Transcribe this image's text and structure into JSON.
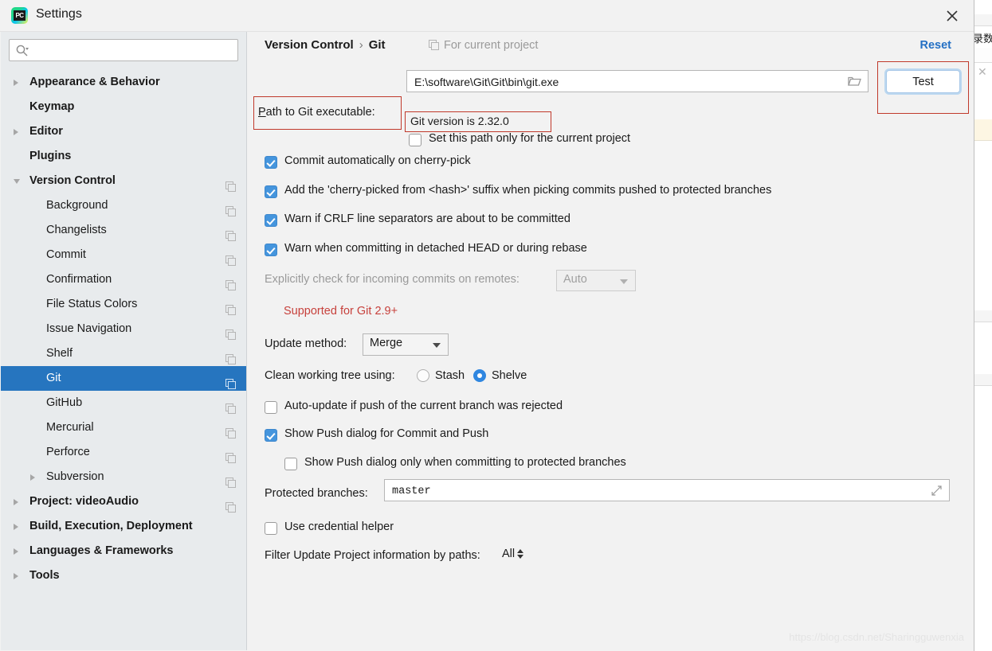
{
  "window": {
    "title": "Settings",
    "logo_icon": "pycharm-logo-icon",
    "close_icon": "close-icon"
  },
  "sidebar": {
    "search": {
      "value": "",
      "placeholder": "",
      "icon": "search-icon"
    },
    "items": [
      {
        "label": "Appearance & Behavior",
        "arrow": "right",
        "bold": true,
        "indent": 36,
        "copy": false,
        "selected": false
      },
      {
        "label": "Keymap",
        "arrow": "none",
        "bold": true,
        "indent": 36,
        "copy": false,
        "selected": false
      },
      {
        "label": "Editor",
        "arrow": "right",
        "bold": true,
        "indent": 36,
        "copy": false,
        "selected": false
      },
      {
        "label": "Plugins",
        "arrow": "none",
        "bold": true,
        "indent": 36,
        "copy": false,
        "selected": false
      },
      {
        "label": "Version Control",
        "arrow": "down",
        "bold": true,
        "indent": 36,
        "copy": true,
        "selected": false
      },
      {
        "label": "Background",
        "arrow": "none",
        "bold": false,
        "indent": 57,
        "copy": true,
        "selected": false
      },
      {
        "label": "Changelists",
        "arrow": "none",
        "bold": false,
        "indent": 57,
        "copy": true,
        "selected": false
      },
      {
        "label": "Commit",
        "arrow": "none",
        "bold": false,
        "indent": 57,
        "copy": true,
        "selected": false
      },
      {
        "label": "Confirmation",
        "arrow": "none",
        "bold": false,
        "indent": 57,
        "copy": true,
        "selected": false
      },
      {
        "label": "File Status Colors",
        "arrow": "none",
        "bold": false,
        "indent": 57,
        "copy": true,
        "selected": false
      },
      {
        "label": "Issue Navigation",
        "arrow": "none",
        "bold": false,
        "indent": 57,
        "copy": true,
        "selected": false
      },
      {
        "label": "Shelf",
        "arrow": "none",
        "bold": false,
        "indent": 57,
        "copy": true,
        "selected": false
      },
      {
        "label": "Git",
        "arrow": "none",
        "bold": false,
        "indent": 57,
        "copy": true,
        "selected": true
      },
      {
        "label": "GitHub",
        "arrow": "none",
        "bold": false,
        "indent": 57,
        "copy": true,
        "selected": false
      },
      {
        "label": "Mercurial",
        "arrow": "none",
        "bold": false,
        "indent": 57,
        "copy": true,
        "selected": false
      },
      {
        "label": "Perforce",
        "arrow": "none",
        "bold": false,
        "indent": 57,
        "copy": true,
        "selected": false
      },
      {
        "label": "Subversion",
        "arrow": "right",
        "bold": false,
        "indent": 57,
        "copy": true,
        "selected": false
      },
      {
        "label": "Project: videoAudio",
        "arrow": "right",
        "bold": true,
        "indent": 36,
        "copy": true,
        "selected": false
      },
      {
        "label": "Build, Execution, Deployment",
        "arrow": "right",
        "bold": true,
        "indent": 36,
        "copy": false,
        "selected": false
      },
      {
        "label": "Languages & Frameworks",
        "arrow": "right",
        "bold": true,
        "indent": 36,
        "copy": false,
        "selected": false
      },
      {
        "label": "Tools",
        "arrow": "right",
        "bold": true,
        "indent": 36,
        "copy": false,
        "selected": false
      }
    ]
  },
  "header": {
    "breadcrumb_root": "Version Control",
    "breadcrumb_sep": "›",
    "breadcrumb_current": "Git",
    "for_current_project": "For current project",
    "for_current_project_icon": "copy-icon",
    "reset_label": "Reset"
  },
  "main": {
    "path_label": "Path to Git executable:",
    "path_label_mnemonic": "P",
    "path_label_rest": "ath to Git executable:",
    "path_value": "E:\\software\\Git\\Git\\bin\\git.exe",
    "folder_icon": "folder-icon",
    "test_button": "Test",
    "set_path_only_label": "Set this path only for the current project",
    "set_path_only_checked": false,
    "git_version": "Git version is 2.32.0",
    "checkboxes": [
      {
        "label": "Commit automatically on cherry-pick",
        "checked": true
      },
      {
        "label": "Add the 'cherry-picked from <hash>' suffix when picking commits pushed to protected branches",
        "checked": true
      },
      {
        "label": "Warn if CRLF line separators are about to be committed",
        "checked": true
      },
      {
        "label": "Warn when committing in detached HEAD or during rebase",
        "checked": true
      }
    ],
    "explicit_check_label": "Explicitly check for incoming commits on remotes:",
    "explicit_check_value": "Auto",
    "supported_note": "Supported for Git 2.9+",
    "update_method_label": "Update method:",
    "update_method_value": "Merge",
    "clean_tree_label": "Clean working tree using:",
    "clean_tree_options": [
      {
        "label": "Stash",
        "selected": false
      },
      {
        "label": "Shelve",
        "selected": true
      }
    ],
    "auto_update_label": "Auto-update if push of the current branch was rejected",
    "auto_update_checked": false,
    "show_push_label": "Show Push dialog for Commit and Push",
    "show_push_checked": true,
    "show_push_protected_label": "Show Push dialog only when committing to protected branches",
    "show_push_protected_checked": false,
    "protected_branches_label": "Protected branches:",
    "protected_branches_value": "master",
    "expand_icon": "expand-icon",
    "use_credential_label": "Use credential helper",
    "use_credential_checked": false,
    "filter_label": "Filter Update Project information by paths:",
    "filter_value": "All"
  },
  "background_window": {
    "cjk_text": "录数"
  },
  "watermark": "https://blog.csdn.net/Sharingguwenxia",
  "colors": {
    "accent_blue": "#2675bf",
    "checkbox_blue": "#4595dd",
    "link_blue": "#2470c4",
    "warn_red": "#c7413c",
    "annotation_red": "#c0392b",
    "sidebar_bg": "#e8ebed",
    "panel_bg": "#f2f2f2"
  }
}
